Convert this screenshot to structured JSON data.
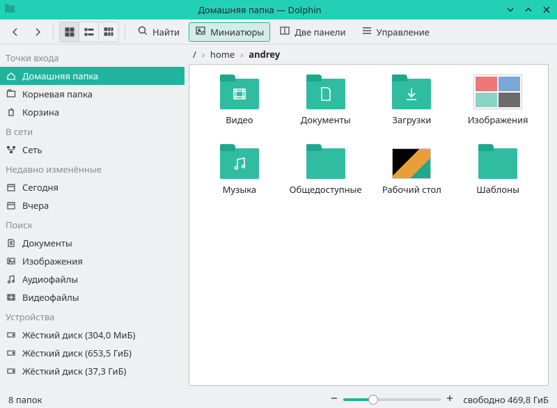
{
  "window": {
    "title": "Домашняя папка — Dolphin"
  },
  "toolbar": {
    "find": "Найти",
    "thumbs": "Миниатюры",
    "split": "Две панели",
    "control": "Управление"
  },
  "sidebar": {
    "sections": {
      "places": "Точки входа",
      "network": "В сети",
      "recent": "Недавно изменённые",
      "search": "Поиск",
      "devices": "Устройства"
    },
    "places": [
      {
        "label": "Домашняя папка",
        "selected": true
      },
      {
        "label": "Корневая папка"
      },
      {
        "label": "Корзина"
      }
    ],
    "network": [
      {
        "label": "Сеть"
      }
    ],
    "recent": [
      {
        "label": "Сегодня"
      },
      {
        "label": "Вчера"
      }
    ],
    "search": [
      {
        "label": "Документы"
      },
      {
        "label": "Изображения"
      },
      {
        "label": "Аудиофайлы"
      },
      {
        "label": "Видеофайлы"
      }
    ],
    "devices": [
      {
        "label": "Жёсткий диск (304,0 МиБ)"
      },
      {
        "label": "Жёсткий диск (653,5 ГиБ)"
      },
      {
        "label": "Жёсткий диск (37,3 ГиБ)"
      }
    ]
  },
  "breadcrumb": {
    "root": "/",
    "items": [
      "home",
      "andrey"
    ]
  },
  "files": [
    {
      "name": "Видео",
      "kind": "video"
    },
    {
      "name": "Документы",
      "kind": "doc"
    },
    {
      "name": "Загрузки",
      "kind": "download"
    },
    {
      "name": "Изображения",
      "kind": "images"
    },
    {
      "name": "Музыка",
      "kind": "music"
    },
    {
      "name": "Общедоступные",
      "kind": "public"
    },
    {
      "name": "Рабочий стол",
      "kind": "desktop"
    },
    {
      "name": "Шаблоны",
      "kind": "templates"
    }
  ],
  "status": {
    "count": "8 папок",
    "free": "свободно 469,8 ГиБ"
  }
}
